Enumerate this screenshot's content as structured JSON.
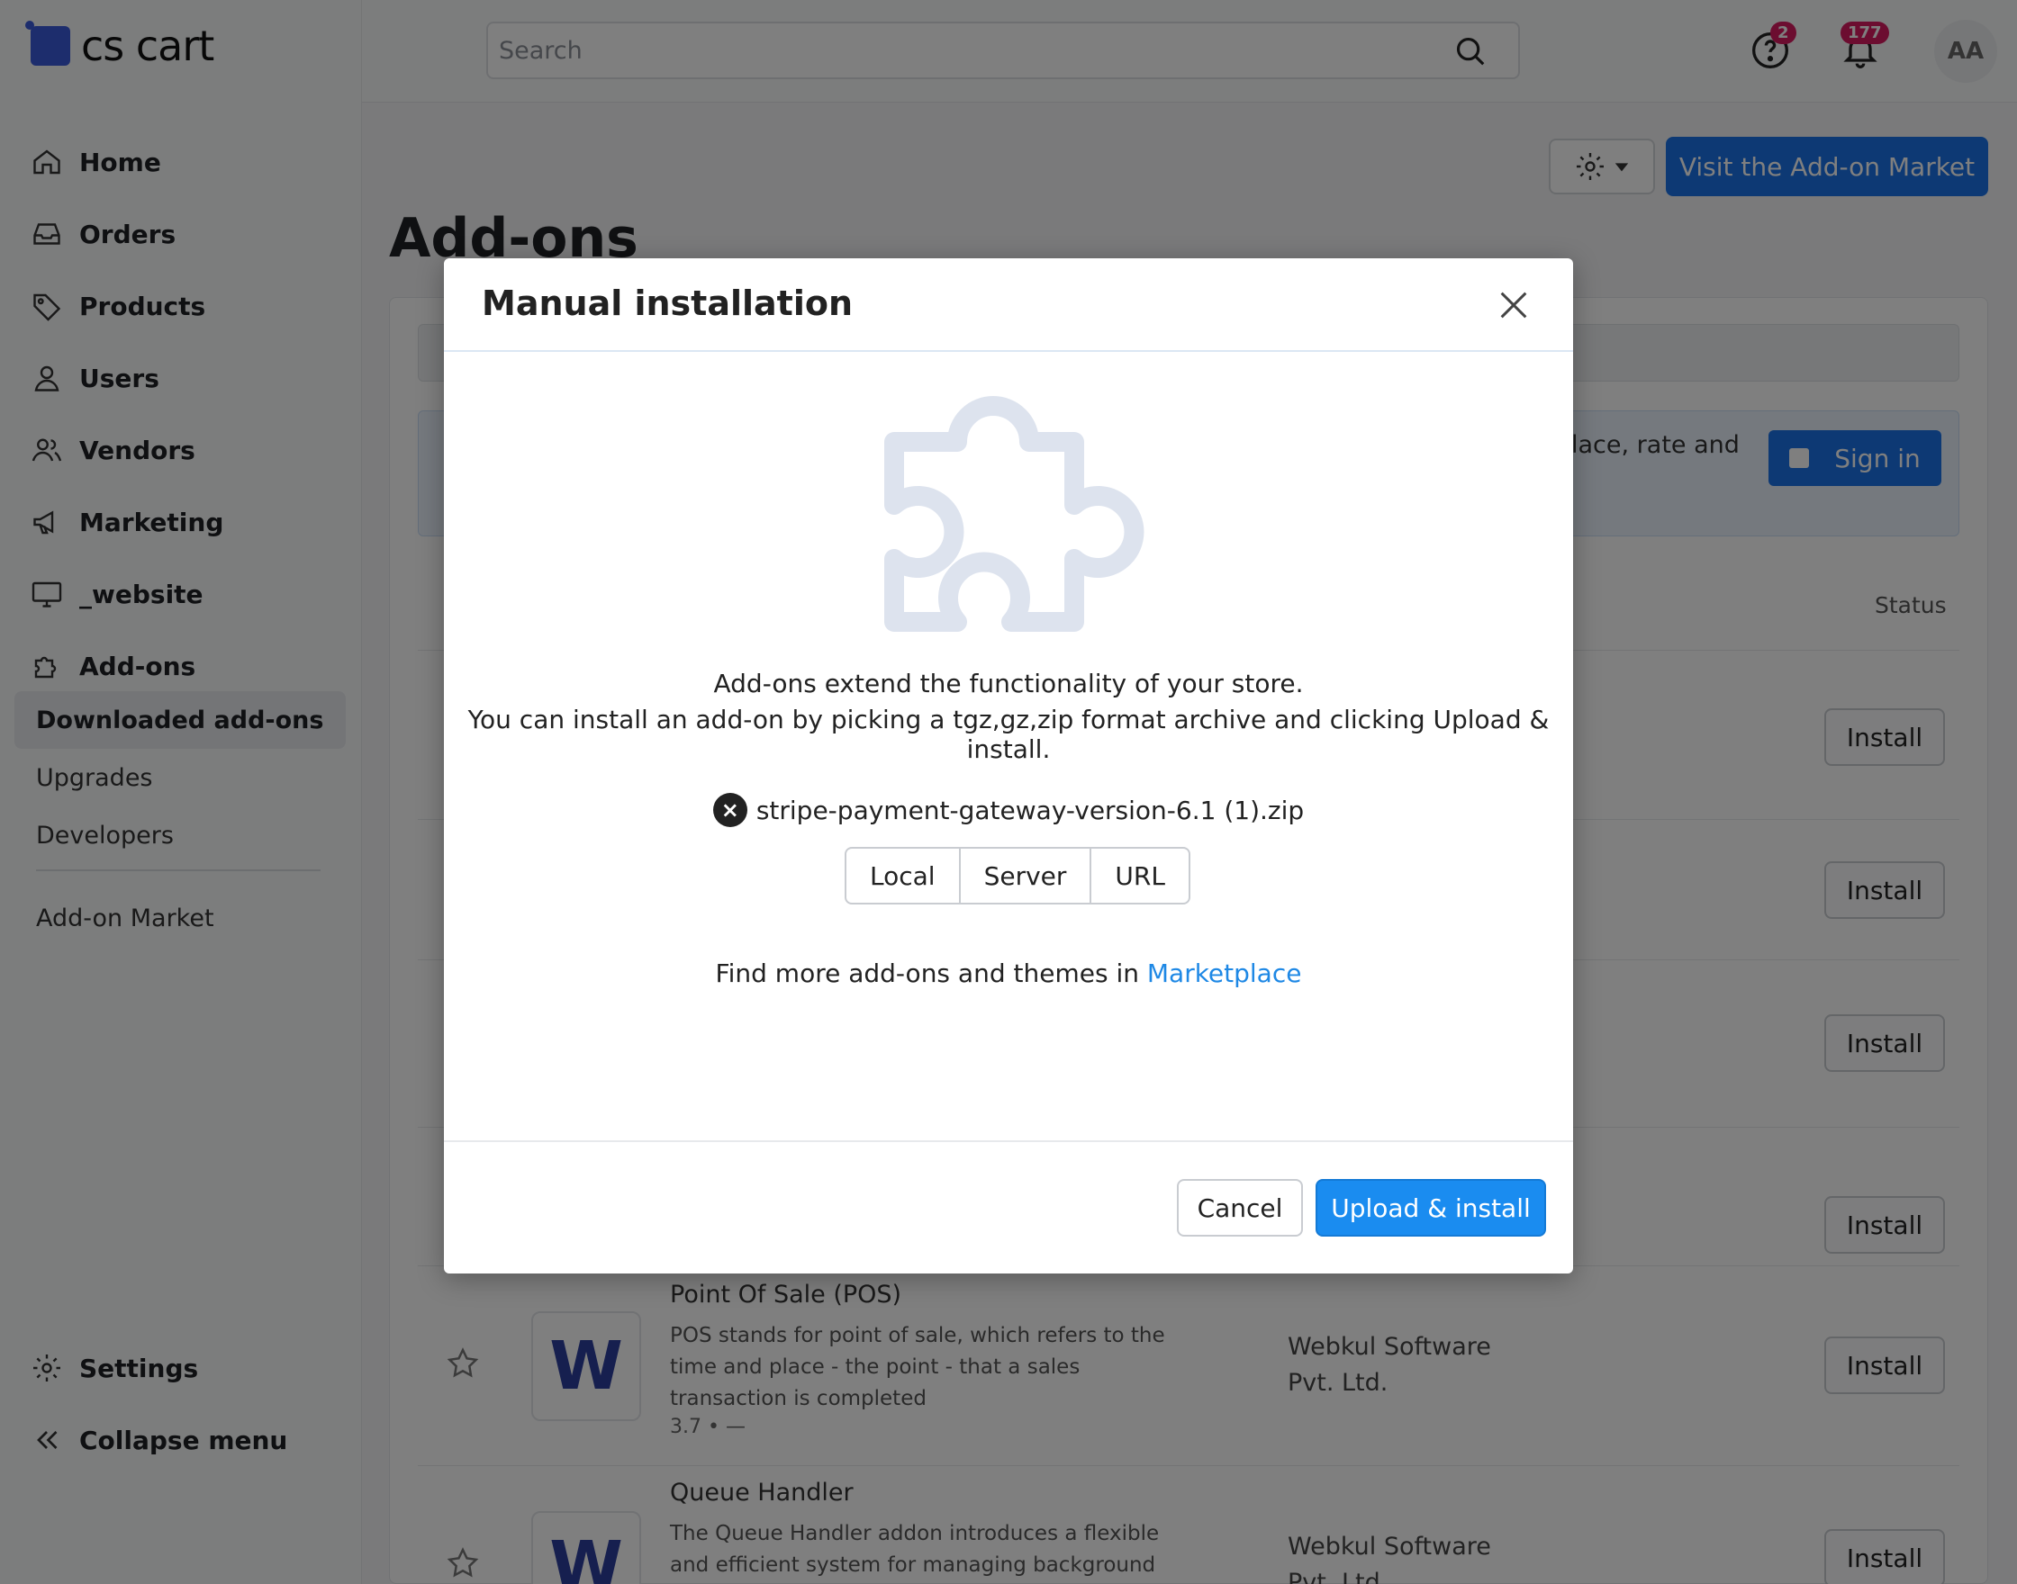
{
  "brand": {
    "name": "cs cart"
  },
  "nav": {
    "items": [
      {
        "label": "Home",
        "icon": "home-icon"
      },
      {
        "label": "Orders",
        "icon": "inbox-icon"
      },
      {
        "label": "Products",
        "icon": "tag-icon"
      },
      {
        "label": "Users",
        "icon": "user-icon"
      },
      {
        "label": "Vendors",
        "icon": "users-icon"
      },
      {
        "label": "Marketing",
        "icon": "megaphone-icon"
      },
      {
        "label": "_website",
        "icon": "monitor-icon"
      },
      {
        "label": "Add-ons",
        "icon": "puzzle-icon"
      }
    ],
    "sub": [
      "Downloaded add-ons",
      "Upgrades",
      "Developers",
      "Add-on Market"
    ],
    "settings": "Settings",
    "collapse": "Collapse menu"
  },
  "topbar": {
    "search_placeholder": "Search",
    "help_badge": "2",
    "notifications_badge": "177",
    "avatar": "AA"
  },
  "page": {
    "title": "Add-ons",
    "market_button": "Visit the Add-on Market",
    "promo_text": "lace, rate and",
    "signin": "Sign in",
    "status_header": "Status",
    "install_label": "Install"
  },
  "addons": [
    {
      "name": "Point Of Sale (POS)",
      "desc": "POS stands for point of sale, which refers to the time and place - the point - that a sales transaction is completed",
      "rating": "3.7 • —",
      "vendor": "Webkul Software Pvt. Ltd."
    },
    {
      "name": "Queue Handler",
      "desc": "The Queue Handler addon introduces a flexible and efficient system for managing background tasks and",
      "vendor": "Webkul Software Pvt. Ltd."
    }
  ],
  "modal": {
    "title": "Manual installation",
    "line1": "Add-ons extend the functionality of your store.",
    "line2": "You can install an add-on by picking a tgz,gz,zip format archive and clicking Upload & install.",
    "file_name": "stripe-payment-gateway-version-6.1 (1).zip",
    "sources": [
      "Local",
      "Server",
      "URL"
    ],
    "market_prefix": "Find more add-ons and themes in",
    "market_link": "Marketplace",
    "cancel": "Cancel",
    "upload": "Upload & install"
  },
  "colors": {
    "accent": "#1a8cf0",
    "brand": "#3b5bdb",
    "badge": "#d81b60"
  }
}
